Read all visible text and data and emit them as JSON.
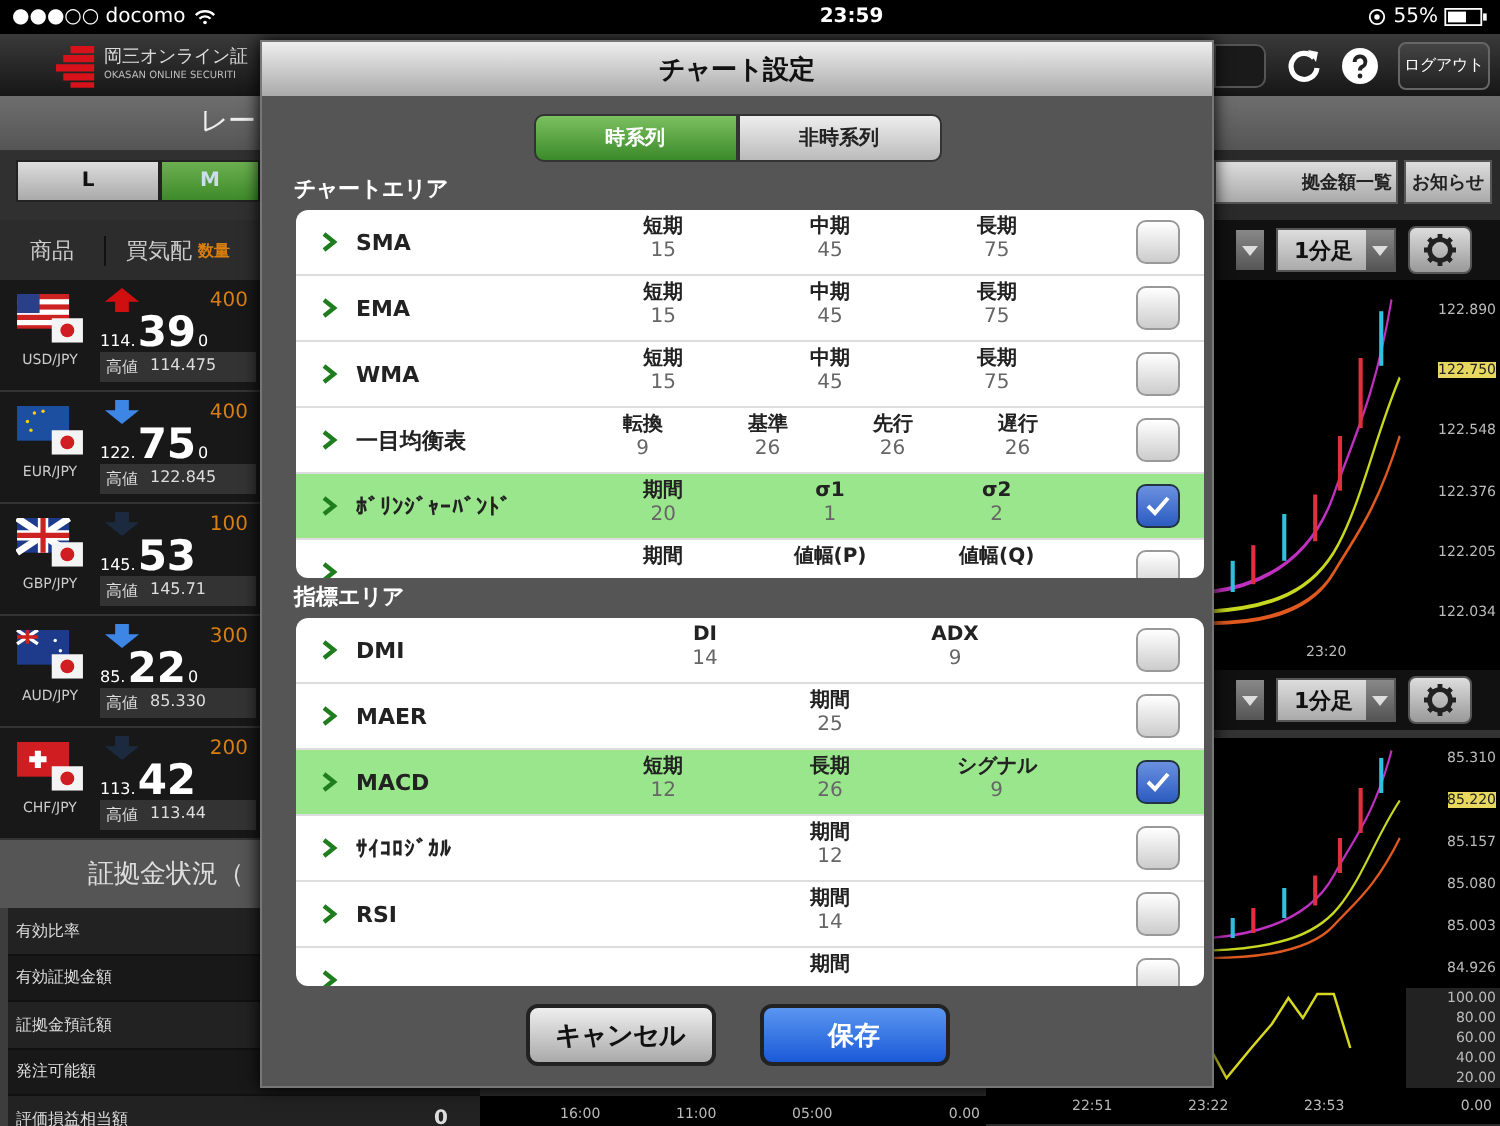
{
  "status_bar": {
    "carrier": "●●●○○ docomo",
    "time": "23:59",
    "battery": "55%"
  },
  "header": {
    "logo_title": "岡三オンライン証",
    "logo_subtitle": "OKASAN ONLINE SECURITI",
    "logout": "ログアウト"
  },
  "screen_title": "レー",
  "size_tabs": [
    {
      "label": "L",
      "selected": false
    },
    {
      "label": "M",
      "selected": true
    }
  ],
  "top_buttons": [
    "拠金額一覧",
    "お知らせ"
  ],
  "rate_columns": {
    "product": "商品",
    "bid": "買気配",
    "qty": "数量"
  },
  "rates": [
    {
      "pair": "USD/JPY",
      "kind": "up",
      "price_head": "114.",
      "price_main": "39",
      "price_tail": "0",
      "qty": "400",
      "high_label": "高値",
      "high": "114.475"
    },
    {
      "pair": "EUR/JPY",
      "kind": "down",
      "price_head": "122.",
      "price_main": "75",
      "price_tail": "0",
      "qty": "400",
      "high_label": "高値",
      "high": "122.845"
    },
    {
      "pair": "GBP/JPY",
      "kind": "flat",
      "price_head": "145.",
      "price_main": "53",
      "qty": "100",
      "high_label": "高値",
      "high": "145.71"
    },
    {
      "pair": "AUD/JPY",
      "kind": "down",
      "price_head": "85.",
      "price_main": "22",
      "price_tail": "0",
      "qty": "300",
      "high_label": "高値",
      "high": "85.330"
    },
    {
      "pair": "CHF/JPY",
      "kind": "flat",
      "price_head": "113.",
      "price_main": "42",
      "qty": "200",
      "high_label": "高値",
      "high": "113.44"
    }
  ],
  "margin": {
    "title": "証拠金状況（",
    "rows": [
      {
        "label": "有効比率"
      },
      {
        "label": "有効証拠金額"
      },
      {
        "label": "証拠金預託額"
      },
      {
        "label": "発注可能額"
      },
      {
        "label": "評価損益相当額",
        "value": "0"
      }
    ]
  },
  "middle_axis": [
    "16:00",
    "11:00",
    "05:00",
    "0.00"
  ],
  "charts": [
    {
      "interval": "1分足",
      "price_tag": "122.750",
      "y_labels": [
        "122.890",
        "122.548",
        "122.376",
        "122.205",
        "122.034"
      ],
      "x_labels": [
        "23:20"
      ]
    },
    {
      "interval": "1分足",
      "price_tag": "85.220",
      "y_labels": [
        "85.310",
        "85.157",
        "85.080",
        "85.003",
        "84.926"
      ],
      "osc_labels": [
        "100.00",
        "80.00",
        "60.00",
        "40.00",
        "20.00"
      ],
      "x_labels": [
        "22:51",
        "23:22",
        "23:53"
      ],
      "x_end": "0.00"
    }
  ],
  "dialog": {
    "title": "チャート設定",
    "tabs": [
      {
        "label": "時系列",
        "selected": true
      },
      {
        "label": "非時系列",
        "selected": false
      }
    ],
    "sections": [
      {
        "title": "チャートエリア",
        "items": [
          {
            "name": "SMA",
            "params": [
              {
                "label": "短期",
                "value": "15"
              },
              {
                "label": "中期",
                "value": "45"
              },
              {
                "label": "長期",
                "value": "75"
              }
            ],
            "checked": false
          },
          {
            "name": "EMA",
            "params": [
              {
                "label": "短期",
                "value": "15"
              },
              {
                "label": "中期",
                "value": "45"
              },
              {
                "label": "長期",
                "value": "75"
              }
            ],
            "checked": false
          },
          {
            "name": "WMA",
            "params": [
              {
                "label": "短期",
                "value": "15"
              },
              {
                "label": "中期",
                "value": "45"
              },
              {
                "label": "長期",
                "value": "75"
              }
            ],
            "checked": false
          },
          {
            "name": "一目均衡表",
            "params": [
              {
                "label": "転換",
                "value": "9"
              },
              {
                "label": "基準",
                "value": "26"
              },
              {
                "label": "先行",
                "value": "26"
              },
              {
                "label": "遅行",
                "value": "26"
              }
            ],
            "checked": false
          },
          {
            "name": "ﾎﾞﾘﾝｼﾞｬｰﾊﾞﾝﾄﾞ",
            "params": [
              {
                "label": "期間",
                "value": "20"
              },
              {
                "label": "σ1",
                "value": "1"
              },
              {
                "label": "σ2",
                "value": "2"
              }
            ],
            "checked": true
          },
          {
            "params": [
              {
                "label": "期間"
              },
              {
                "label": "値幅(P)"
              },
              {
                "label": "値幅(Q)"
              }
            ],
            "checked": false
          }
        ]
      },
      {
        "title": "指標エリア",
        "items": [
          {
            "name": "DMI",
            "params": [
              {
                "label": "DI",
                "value": "14"
              },
              {
                "label": "ADX",
                "value": "9"
              }
            ],
            "checked": false
          },
          {
            "name": "MAER",
            "params": [
              {
                "label": "期間",
                "value": "25"
              }
            ],
            "checked": false
          },
          {
            "name": "MACD",
            "params": [
              {
                "label": "短期",
                "value": "12"
              },
              {
                "label": "長期",
                "value": "26"
              },
              {
                "label": "シグナル",
                "value": "9"
              }
            ],
            "checked": true
          },
          {
            "name": "ｻｲｺﾛｼﾞｶﾙ",
            "params": [
              {
                "label": "期間",
                "value": "12"
              }
            ],
            "checked": false
          },
          {
            "name": "RSI",
            "params": [
              {
                "label": "期間",
                "value": "14"
              }
            ],
            "checked": false
          },
          {
            "params": [
              {
                "label": "期間"
              }
            ],
            "checked": false
          }
        ]
      }
    ],
    "buttons": [
      {
        "label": "キャンセル",
        "kind": "cancel"
      },
      {
        "label": "保存",
        "kind": "primary"
      }
    ]
  }
}
